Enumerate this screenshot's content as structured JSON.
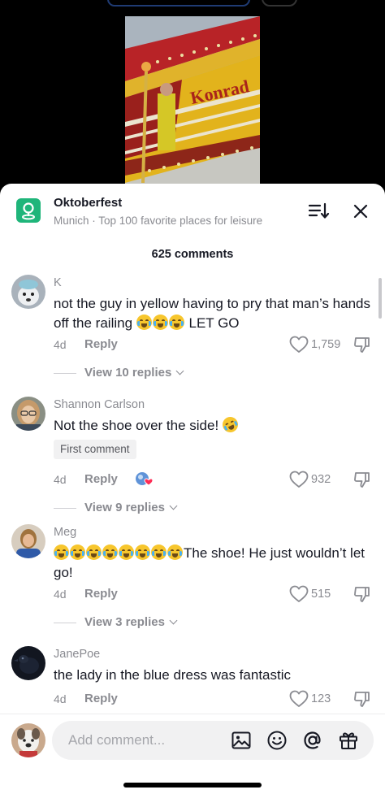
{
  "place": {
    "title": "Oktoberfest",
    "subtitle": "Munich · Top 100 favorite places for leisure",
    "thumbnail_sign": "Konrad"
  },
  "comment_count_label": "625 comments",
  "comments": [
    {
      "username": "K",
      "text_parts": [
        "not the guy in yellow having to pry that man’s hands off the railing ",
        " LET GO"
      ],
      "emojis": [
        "loudly-crying-face",
        "loudly-crying-face",
        "loudly-crying-face"
      ],
      "time": "4d",
      "reply_label": "Reply",
      "likes": "1,759",
      "view_replies": "View 10 replies"
    },
    {
      "username": "Shannon Carlson",
      "text": "Not the shoe over the side! ",
      "emojis": [
        "rolling-on-floor-laughing-face"
      ],
      "badge": "First comment",
      "time": "4d",
      "reply_label": "Reply",
      "creator_liked": true,
      "likes": "932",
      "view_replies": "View 9 replies"
    },
    {
      "username": "Meg",
      "text": "The shoe! He just wouldn’t let go!",
      "emojis": [
        "loudly-crying-face",
        "loudly-crying-face",
        "loudly-crying-face",
        "loudly-crying-face",
        "loudly-crying-face",
        "loudly-crying-face",
        "loudly-crying-face",
        "loudly-crying-face"
      ],
      "time": "4d",
      "reply_label": "Reply",
      "likes": "515",
      "view_replies": "View 3 replies"
    },
    {
      "username": "JanePoe",
      "text": "the lady in the blue dress was fantastic",
      "time": "4d",
      "reply_label": "Reply",
      "likes": "123"
    }
  ],
  "input": {
    "placeholder": "Add comment..."
  },
  "icons": {
    "place": "location-pin-icon",
    "sort": "sort-icon",
    "close": "close-icon",
    "like": "heart-icon",
    "dislike": "thumbs-down-icon",
    "image": "image-icon",
    "emoji": "emoji-icon",
    "mention": "at-mention-icon",
    "gift": "gift-icon"
  },
  "colors": {
    "accent_green": "#1fb57a",
    "text_primary": "#161823",
    "text_secondary": "#8a8b91"
  }
}
